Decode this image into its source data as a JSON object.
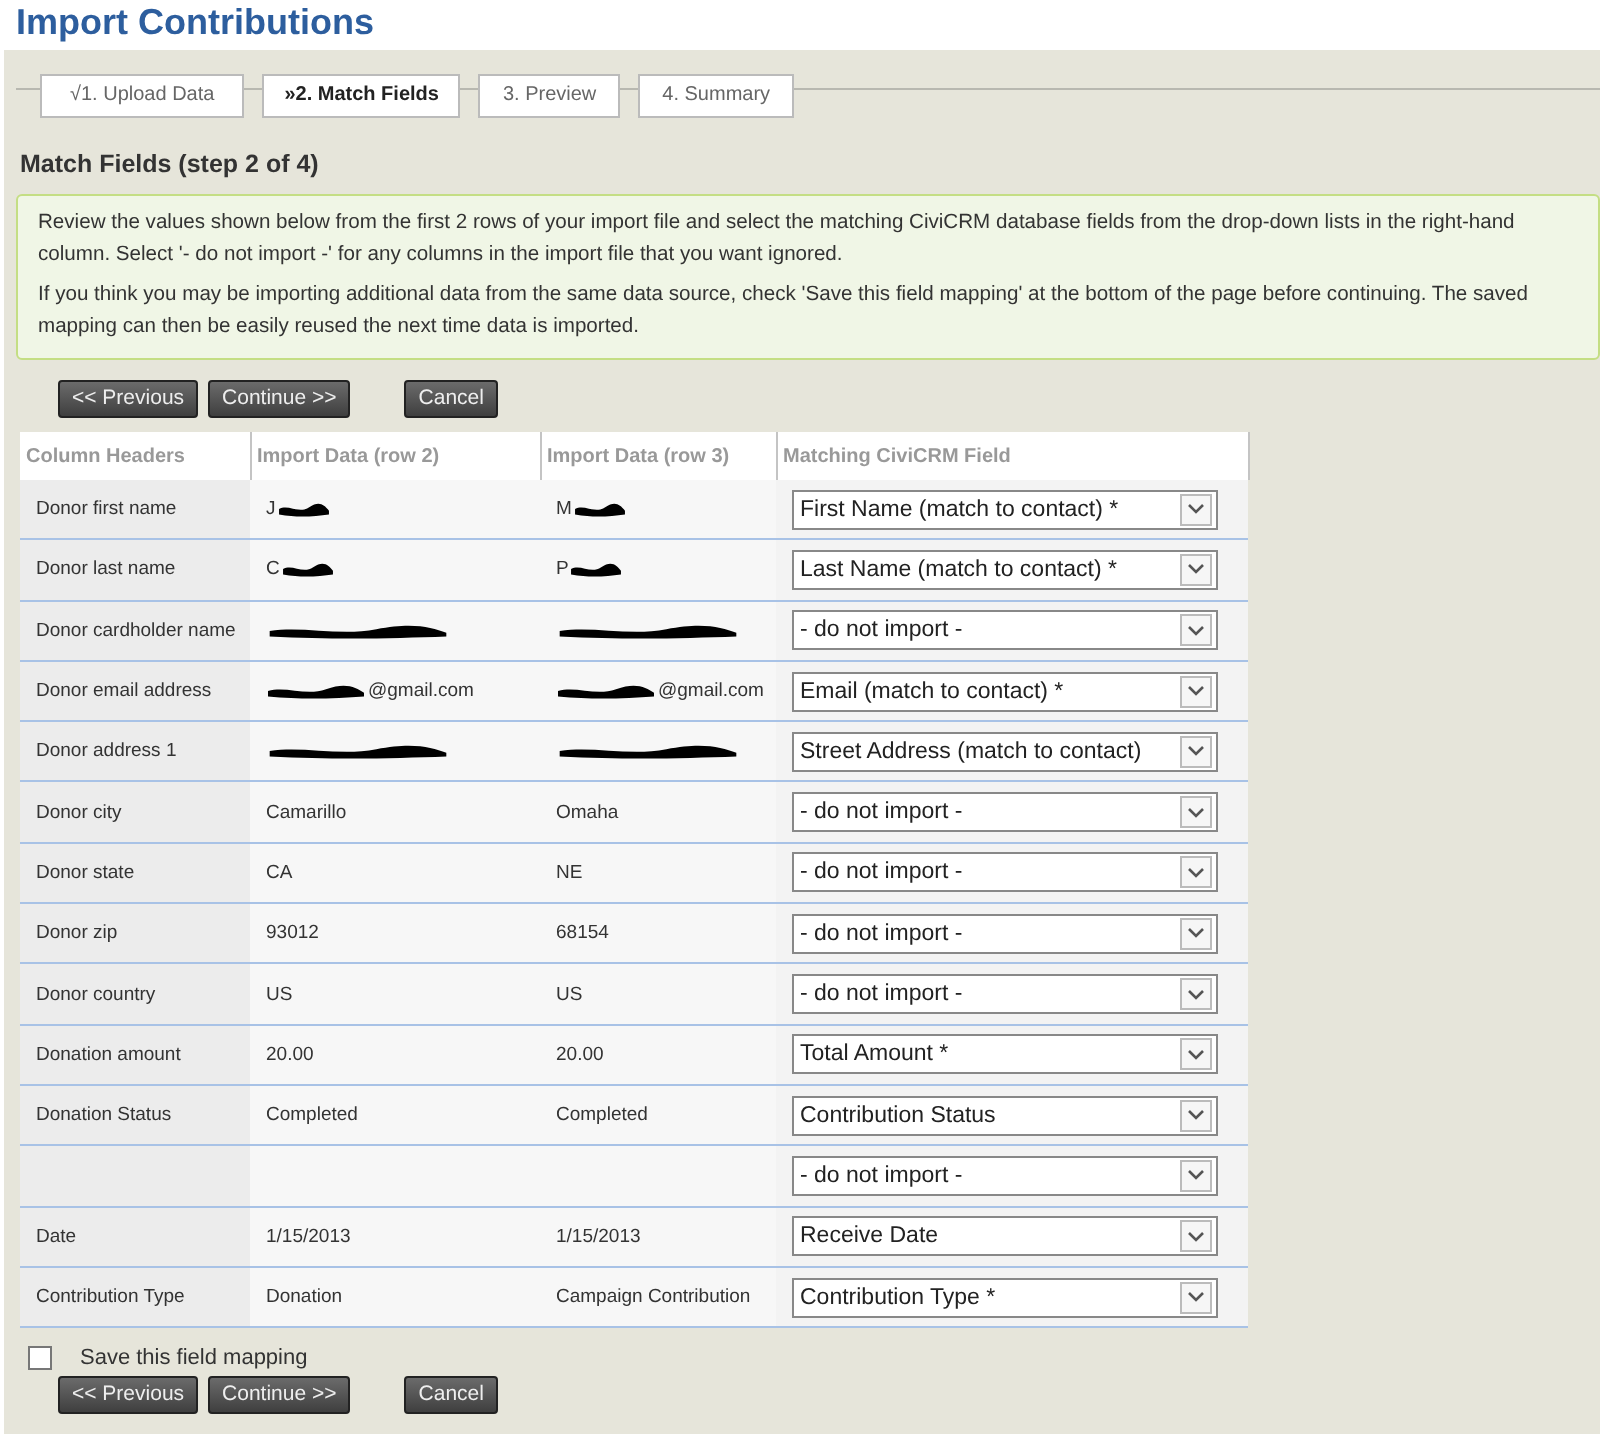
{
  "page_title": "Import Contributions",
  "steps": [
    {
      "label": "√1. Upload Data",
      "selected": false
    },
    {
      "label": "»2. Match Fields",
      "selected": true
    },
    {
      "label": "3. Preview",
      "selected": false
    },
    {
      "label": "4. Summary",
      "selected": false
    }
  ],
  "section_title": "Match Fields (step 2 of 4)",
  "help": [
    "Review the values shown below from the first 2 rows of your import file and select the matching CiviCRM database fields from the drop-down lists in the right-hand column. Select '- do not import -' for any columns in the import file that you want ignored.",
    "If you think you may be importing additional data from the same data source, check 'Save this field mapping' at the bottom of the page before continuing. The saved mapping can then be easily reused the next time data is imported."
  ],
  "buttons": [
    "<< Previous",
    "Continue >>",
    "Cancel"
  ],
  "table": {
    "columns": [
      "Column Headers",
      "Import Data (row 2)",
      "Import Data (row 3)",
      "Matching CiviCRM Field"
    ],
    "rows": [
      {
        "header": "Donor first name",
        "row2": {
          "text": "J",
          "kind": "tail_hidden"
        },
        "row3": {
          "text": "M",
          "kind": "tail_hidden"
        },
        "field": "First Name (match to contact) *"
      },
      {
        "header": "Donor last name",
        "row2": {
          "text": "C",
          "kind": "tail_hidden"
        },
        "row3": {
          "text": "P",
          "kind": "tail_hidden"
        },
        "field": "Last Name (match to contact) *"
      },
      {
        "header": "Donor cardholder name",
        "row2": {
          "kind": "hidden"
        },
        "row3": {
          "kind": "hidden"
        },
        "field": "- do not import -"
      },
      {
        "header": "Donor email address",
        "row2": {
          "text": "@gmail.com",
          "kind": "head_hidden"
        },
        "row3": {
          "text": "@gmail.com",
          "kind": "head_hidden"
        },
        "field": "Email (match to contact) *"
      },
      {
        "header": "Donor address 1",
        "row2": {
          "kind": "hidden"
        },
        "row3": {
          "kind": "hidden"
        },
        "field": "Street Address (match to contact)"
      },
      {
        "header": "Donor city",
        "row2": {
          "text": "Camarillo"
        },
        "row3": {
          "text": "Omaha"
        },
        "field": "- do not import -"
      },
      {
        "header": "Donor state",
        "row2": {
          "text": "CA"
        },
        "row3": {
          "text": "NE"
        },
        "field": "- do not import -"
      },
      {
        "header": "Donor zip",
        "row2": {
          "text": "93012"
        },
        "row3": {
          "text": "68154"
        },
        "field": "- do not import -"
      },
      {
        "header": "Donor country",
        "row2": {
          "text": "US"
        },
        "row3": {
          "text": "US"
        },
        "field": "- do not import -"
      },
      {
        "header": "Donation amount",
        "row2": {
          "text": "20.00"
        },
        "row3": {
          "text": "20.00"
        },
        "field": "Total Amount *"
      },
      {
        "header": "Donation Status",
        "row2": {
          "text": "Completed"
        },
        "row3": {
          "text": "Completed"
        },
        "field": "Contribution Status"
      },
      {
        "row2": {},
        "row3": {},
        "field": "- do not import -"
      },
      {
        "header": "Date",
        "row2": {
          "text": "1/15/2013"
        },
        "row3": {
          "text": "1/15/2013"
        },
        "field": "Receive Date"
      },
      {
        "header": "Contribution Type",
        "row2": {
          "text": "Donation"
        },
        "row3": {
          "text": "Campaign Contribution"
        },
        "field": "Contribution Type *"
      }
    ]
  },
  "save_mapping": {
    "label": "Save this field mapping",
    "checked": false
  },
  "bottom_buttons": [
    "<< Previous",
    "Continue >>",
    "Cancel"
  ]
}
